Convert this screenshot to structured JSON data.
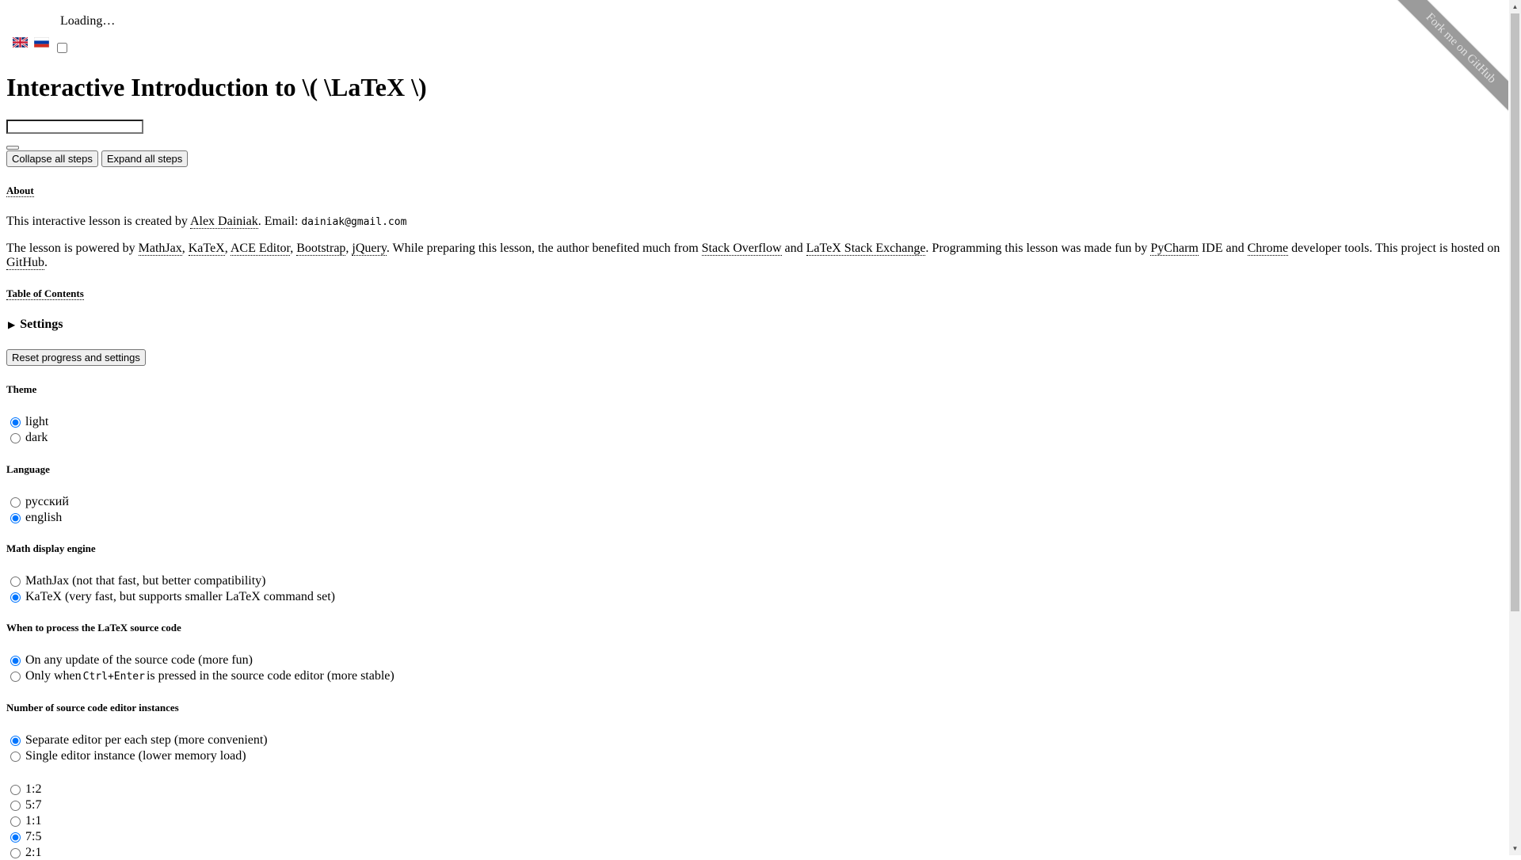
{
  "loading_text": "Loading…",
  "flags": {
    "en_icon": "uk-flag-icon",
    "ru_icon": "russia-flag-icon"
  },
  "title": "Interactive Introduction to \\( \\LaTeX \\)",
  "buttons": {
    "collapse": "Collapse all steps",
    "expand": "Expand all steps",
    "reset": "Reset progress and settings"
  },
  "ribbon": "Fork me on GitHub",
  "about": {
    "heading": "About",
    "p1_prefix": "This interactive lesson is created by ",
    "author": "Alex Dainiak",
    "p1_email_label": ". Email: ",
    "email": "dainiak@gmail.com",
    "p2": {
      "t0": "The lesson is powered by ",
      "mathjax": "MathJax",
      "s1": ", ",
      "katex": "KaTeX",
      "s2": ", ",
      "ace": "ACE Editor",
      "s3": ", ",
      "bootstrap": "Bootstrap",
      "s4": ", ",
      "jquery": "jQuery",
      "t1": ". While preparing this lesson, the author benefited much from ",
      "so": "Stack Overflow",
      "t2": " and ",
      "lse": "LaTeX Stack Exchange",
      "t3": ". Programming this lesson was made fun by ",
      "pycharm": "PyCharm",
      "t4": " IDE and ",
      "chrome": "Chrome",
      "t5": " developer tools. This project is hosted on ",
      "github": "GitHub",
      "t6": "."
    }
  },
  "toc_heading": "Table of Contents",
  "settings": {
    "summary": "Settings",
    "theme": {
      "label": "Theme",
      "options": [
        "light",
        "dark"
      ],
      "selected": "light"
    },
    "language": {
      "label": "Language",
      "options": [
        "русский",
        "english"
      ],
      "selected": "english"
    },
    "math_engine": {
      "label": "Math display engine",
      "options": [
        "MathJax (not that fast, but better compatibility)",
        "KaTeX (very fast, but supports smaller LaTeX command set)"
      ],
      "selected": "KaTeX (very fast, but supports smaller LaTeX command set)"
    },
    "process": {
      "label": "When to process the LaTeX source code",
      "opt1": "On any update of the source code (more fun)",
      "opt2_prefix": "Only when ",
      "opt2_key": "Ctrl+Enter",
      "opt2_suffix": " is pressed in the source code editor (more stable)",
      "selected": "opt1"
    },
    "editors": {
      "label": "Number of source code editor instances",
      "options": [
        "Separate editor per each step (more convenient)",
        "Single editor instance (lower memory load)"
      ],
      "selected": "Separate editor per each step (more convenient)"
    },
    "ratio": {
      "options": [
        "1:2",
        "5:7",
        "1:1",
        "7:5",
        "2:1"
      ],
      "selected": "7:5"
    }
  }
}
